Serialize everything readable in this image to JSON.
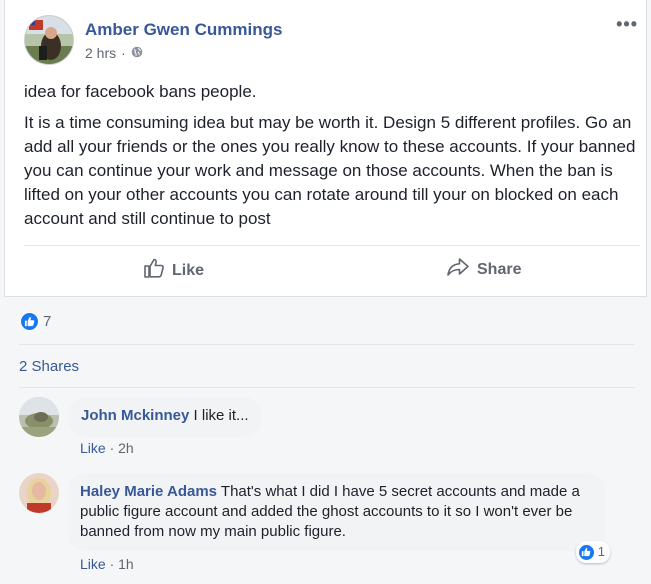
{
  "post": {
    "author": "Amber Gwen Cummings",
    "time": "2 hrs",
    "privacy_icon": "globe-icon",
    "more_label": "•••",
    "paragraphs": [
      "idea for facebook bans people.",
      "It is a time consuming idea but may be worth it. Design 5 different profiles. Go an add all your friends or the ones you really know to these accounts. If your banned you can continue your work and message on those accounts. When the ban is lifted on your other accounts you can rotate around till your on blocked on each account and still continue to post"
    ],
    "actions": {
      "like": "Like",
      "share": "Share"
    }
  },
  "reactions": {
    "count": "7"
  },
  "shares": "2 Shares",
  "comments": [
    {
      "name": "John Mckinney",
      "text": "I like it...",
      "like": "Like",
      "time": "2h"
    },
    {
      "name": "Haley Marie Adams",
      "text": "That's what I did I have 5 secret accounts and made a public figure account and added the ghost accounts to it so I won't ever be banned from now my main public figure.",
      "like": "Like",
      "time": "1h",
      "reaction_count": "1"
    }
  ],
  "colors": {
    "brand_blue": "#385898",
    "like_blue": "#1877f2"
  }
}
